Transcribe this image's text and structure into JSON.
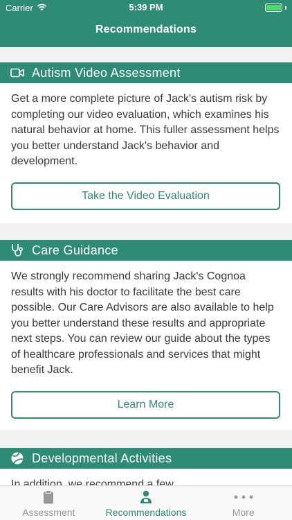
{
  "status_bar": {
    "carrier": "Carrier",
    "time": "5:39 PM"
  },
  "nav": {
    "title": "Recommendations"
  },
  "cards": [
    {
      "title": "Autism Video Assessment",
      "icon": "video-camera-icon",
      "text": "Get a more complete picture of Jack's autism risk by completing our video evaluation, which examines his natural behavior at home. This fuller assessment helps you better understand Jack's behavior and development.",
      "button": "Take the Video Evaluation"
    },
    {
      "title": "Care Guidance",
      "icon": "stethoscope-icon",
      "text": "We strongly recommend sharing Jack's Cognoa results with his doctor to facilitate the best care possible.  Our Care Advisors are also available to help you better understand these results and appropriate next steps.  You can review our guide about the types of healthcare professionals and services that might benefit Jack.",
      "button": "Learn More"
    },
    {
      "title": "Developmental Activities",
      "icon": "ball-icon",
      "text": "In addition, we recommend a few ..."
    }
  ],
  "tabbar": {
    "tabs": [
      {
        "label": "Assessment",
        "icon": "clipboard-icon"
      },
      {
        "label": "Recommendations",
        "icon": "person-icon"
      },
      {
        "label": "More",
        "icon": "ellipsis-icon"
      }
    ],
    "active_index": 1
  },
  "colors": {
    "brand": "#2e8b74",
    "battery": "#4cd964"
  }
}
